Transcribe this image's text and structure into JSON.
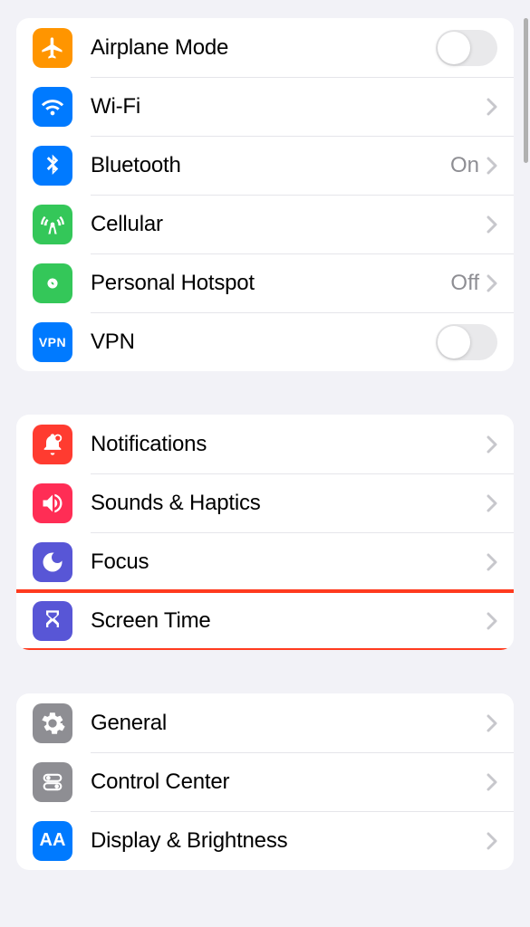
{
  "sections": [
    {
      "items": [
        {
          "id": "airplane-mode",
          "label": "Airplane Mode",
          "icon": "airplane",
          "bg": "#ff9500",
          "accessory": "toggle",
          "on": false
        },
        {
          "id": "wifi",
          "label": "Wi-Fi",
          "icon": "wifi",
          "bg": "#007aff",
          "accessory": "disclosure",
          "value": ""
        },
        {
          "id": "bluetooth",
          "label": "Bluetooth",
          "icon": "bluetooth",
          "bg": "#007aff",
          "accessory": "disclosure",
          "value": "On"
        },
        {
          "id": "cellular",
          "label": "Cellular",
          "icon": "cellular",
          "bg": "#34c759",
          "accessory": "disclosure",
          "value": ""
        },
        {
          "id": "hotspot",
          "label": "Personal Hotspot",
          "icon": "hotspot",
          "bg": "#34c759",
          "accessory": "disclosure",
          "value": "Off"
        },
        {
          "id": "vpn",
          "label": "VPN",
          "icon": "vpn",
          "bg": "#007aff",
          "accessory": "toggle",
          "on": false
        }
      ]
    },
    {
      "items": [
        {
          "id": "notifications",
          "label": "Notifications",
          "icon": "bell",
          "bg": "#ff3b30",
          "accessory": "disclosure"
        },
        {
          "id": "sounds",
          "label": "Sounds & Haptics",
          "icon": "speaker",
          "bg": "#ff2d55",
          "accessory": "disclosure"
        },
        {
          "id": "focus",
          "label": "Focus",
          "icon": "moon",
          "bg": "#5856d6",
          "accessory": "disclosure"
        },
        {
          "id": "screentime",
          "label": "Screen Time",
          "icon": "hourglass",
          "bg": "#5856d6",
          "accessory": "disclosure",
          "highlight": true
        }
      ]
    },
    {
      "items": [
        {
          "id": "general",
          "label": "General",
          "icon": "gear",
          "bg": "#8e8e93",
          "accessory": "disclosure"
        },
        {
          "id": "controlcenter",
          "label": "Control Center",
          "icon": "switches",
          "bg": "#8e8e93",
          "accessory": "disclosure"
        },
        {
          "id": "display",
          "label": "Display & Brightness",
          "icon": "aa",
          "bg": "#007aff",
          "accessory": "disclosure"
        }
      ]
    }
  ]
}
